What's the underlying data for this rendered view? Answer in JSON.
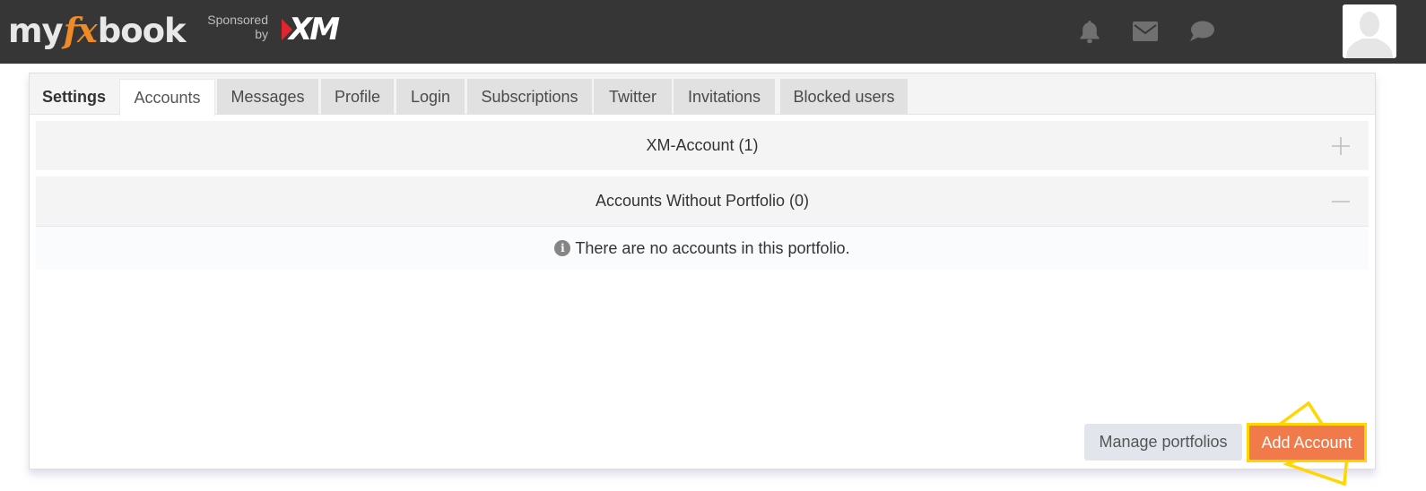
{
  "header": {
    "logo": {
      "part1": "my",
      "part2": "fx",
      "part3": "book"
    },
    "sponsored_line1": "Sponsored",
    "sponsored_line2": "by",
    "sponsor_logo": "XM",
    "icons": [
      "bell-icon",
      "envelope-icon",
      "chat-bubble-icon"
    ],
    "avatar": "user-silhouette"
  },
  "tabs": [
    {
      "label": "Settings",
      "active": false
    },
    {
      "label": "Accounts",
      "active": true
    },
    {
      "label": "Messages",
      "active": false
    },
    {
      "label": "Profile",
      "active": false
    },
    {
      "label": "Login",
      "active": false
    },
    {
      "label": "Subscriptions",
      "active": false
    },
    {
      "label": "Twitter",
      "active": false
    },
    {
      "label": "Invitations",
      "active": false
    },
    {
      "label": "Blocked users",
      "active": false
    }
  ],
  "portfolios": [
    {
      "title": "XM-Account (1)",
      "expanded": false,
      "toggle": "plus-icon"
    },
    {
      "title": "Accounts Without Portfolio (0)",
      "expanded": true,
      "toggle": "minus-icon"
    }
  ],
  "empty_message": "There are no accounts in this portfolio.",
  "buttons": {
    "manage": "Manage portfolios",
    "add": "Add Account"
  },
  "colors": {
    "header_bg": "#363636",
    "logo_accent": "#f08a24",
    "add_button": "#f07a4a",
    "highlight": "#ffd600"
  }
}
